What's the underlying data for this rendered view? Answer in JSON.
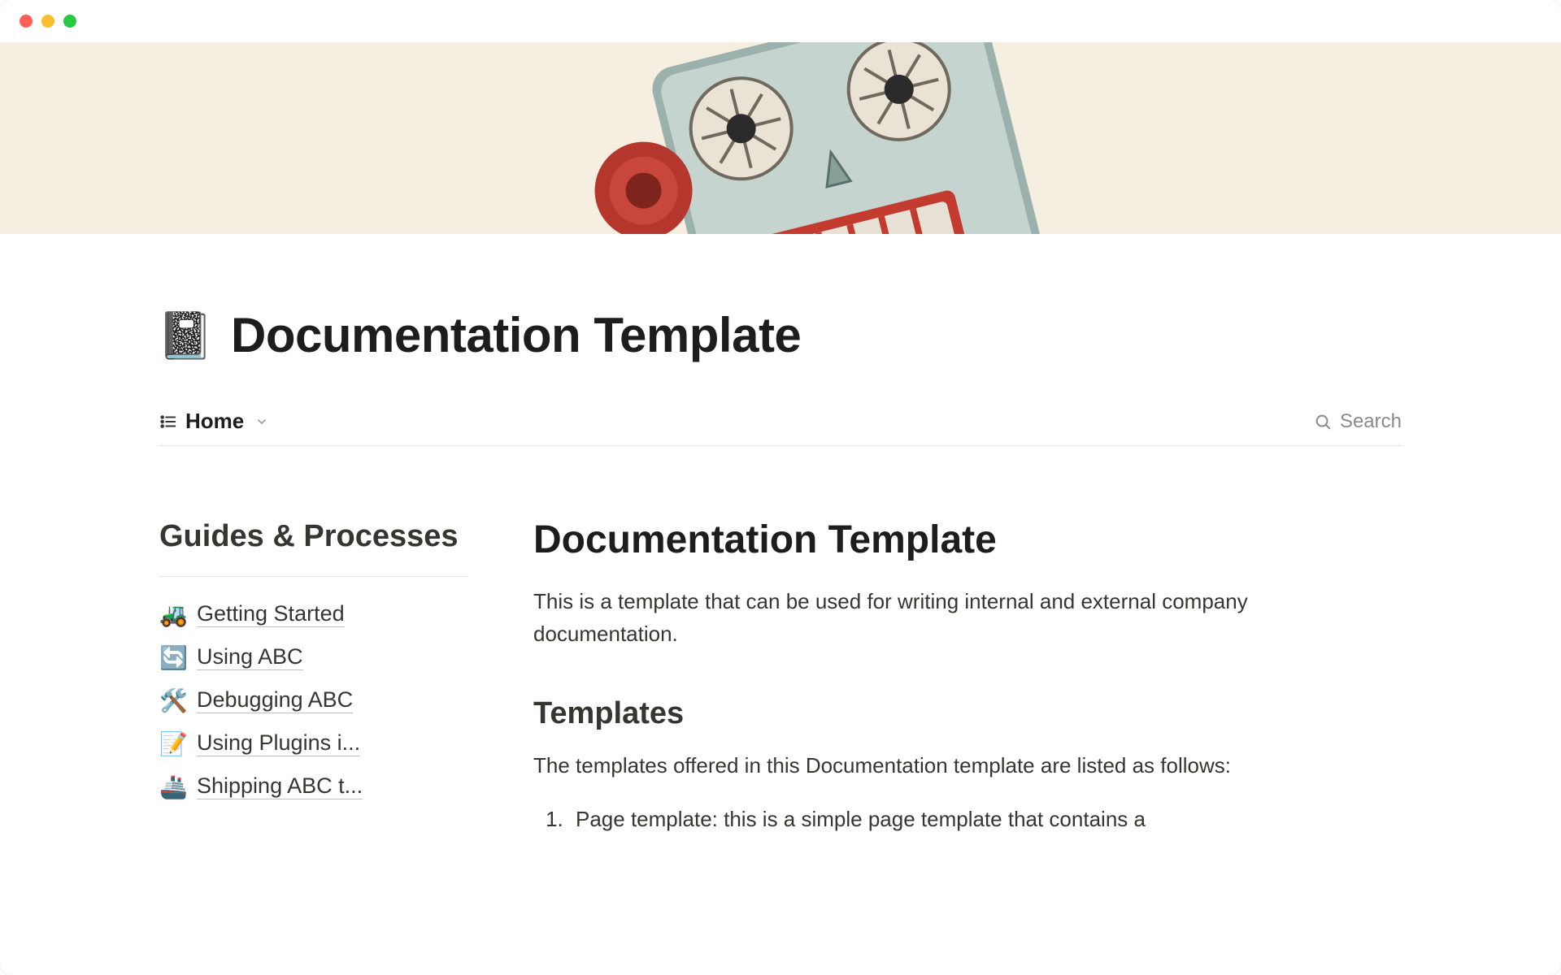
{
  "page": {
    "icon": "📓",
    "title": "Documentation Template"
  },
  "toolbar": {
    "view_icon": "list",
    "view_label": "Home",
    "search_label": "Search"
  },
  "sidebar": {
    "heading": "Guides & Processes",
    "items": [
      {
        "emoji": "🚜",
        "label": "Getting Started"
      },
      {
        "emoji": "🔄",
        "label": "Using ABC"
      },
      {
        "emoji": "🛠️",
        "label": "Debugging ABC"
      },
      {
        "emoji": "📝",
        "label": "Using Plugins i..."
      },
      {
        "emoji": "🚢",
        "label": "Shipping ABC t..."
      }
    ]
  },
  "main": {
    "heading": "Documentation Template",
    "intro": "This is a template that can be used for writing internal and external company documentation.",
    "section_heading": "Templates",
    "section_lead": "The templates offered in this Documentation template are listed as follows:",
    "list": [
      "Page template: this is a simple page template that contains a"
    ]
  }
}
